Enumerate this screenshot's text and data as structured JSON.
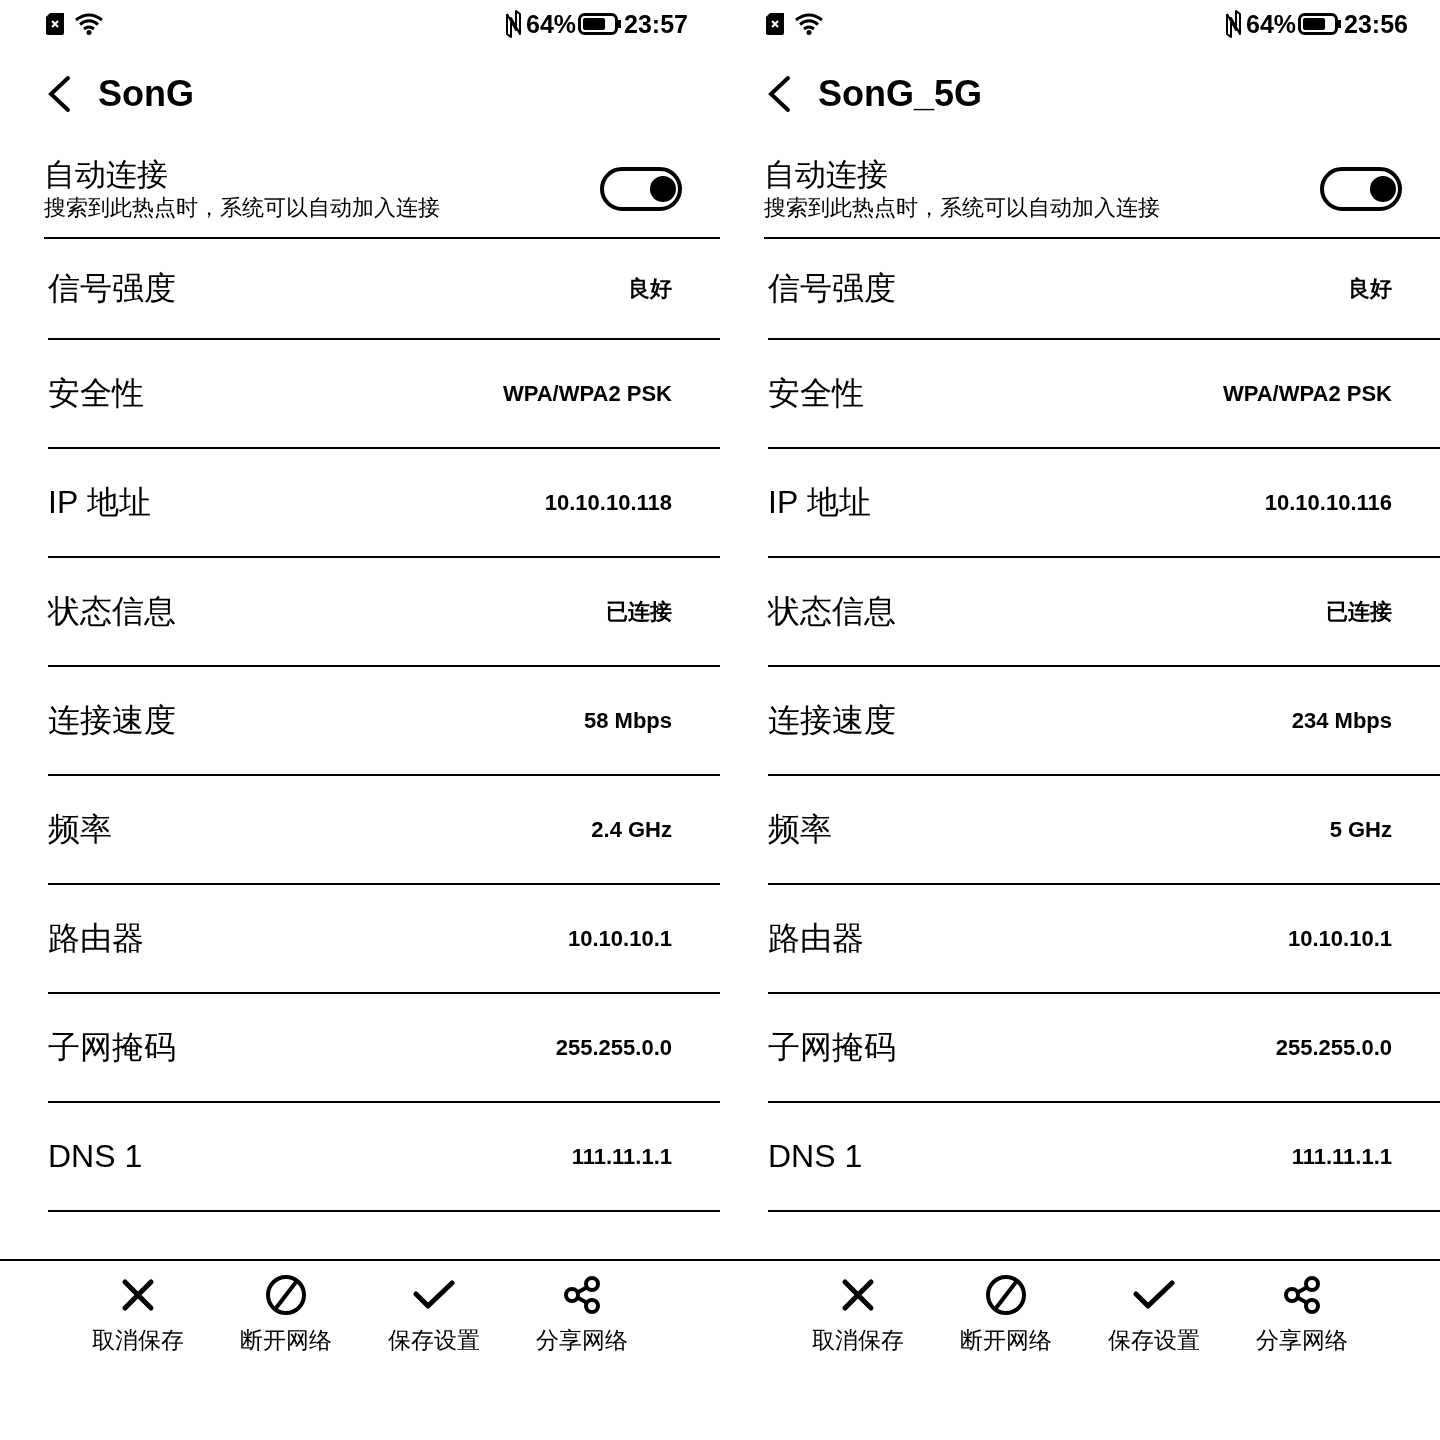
{
  "panels": [
    {
      "status_bar": {
        "battery_percent": "64%",
        "time": "23:57"
      },
      "title": "SonG",
      "auto_connect": {
        "title": "自动连接",
        "subtitle": "搜索到此热点时，系统可以自动加入连接",
        "on": true
      },
      "details": [
        {
          "label": "信号强度",
          "value": "良好"
        },
        {
          "label": "安全性",
          "value": "WPA/WPA2 PSK"
        },
        {
          "label": "IP 地址",
          "value": "10.10.10.118"
        },
        {
          "label": "状态信息",
          "value": "已连接"
        },
        {
          "label": "连接速度",
          "value": "58 Mbps"
        },
        {
          "label": "频率",
          "value": "2.4 GHz"
        },
        {
          "label": "路由器",
          "value": "10.10.10.1"
        },
        {
          "label": "子网掩码",
          "value": "255.255.0.0"
        },
        {
          "label": "DNS 1",
          "value": "111.11.1.1"
        }
      ],
      "actions": [
        {
          "kind": "cancel",
          "label": "取消保存"
        },
        {
          "kind": "disconnect",
          "label": "断开网络"
        },
        {
          "kind": "save",
          "label": "保存设置"
        },
        {
          "kind": "share",
          "label": "分享网络"
        }
      ]
    },
    {
      "status_bar": {
        "battery_percent": "64%",
        "time": "23:56"
      },
      "title": "SonG_5G",
      "auto_connect": {
        "title": "自动连接",
        "subtitle": "搜索到此热点时，系统可以自动加入连接",
        "on": true
      },
      "details": [
        {
          "label": "信号强度",
          "value": "良好"
        },
        {
          "label": "安全性",
          "value": "WPA/WPA2 PSK"
        },
        {
          "label": "IP 地址",
          "value": "10.10.10.116"
        },
        {
          "label": "状态信息",
          "value": "已连接"
        },
        {
          "label": "连接速度",
          "value": "234 Mbps"
        },
        {
          "label": "频率",
          "value": "5 GHz"
        },
        {
          "label": "路由器",
          "value": "10.10.10.1"
        },
        {
          "label": "子网掩码",
          "value": "255.255.0.0"
        },
        {
          "label": "DNS 1",
          "value": "111.11.1.1"
        }
      ],
      "actions": [
        {
          "kind": "cancel",
          "label": "取消保存"
        },
        {
          "kind": "disconnect",
          "label": "断开网络"
        },
        {
          "kind": "save",
          "label": "保存设置"
        },
        {
          "kind": "share",
          "label": "分享网络"
        }
      ]
    }
  ]
}
